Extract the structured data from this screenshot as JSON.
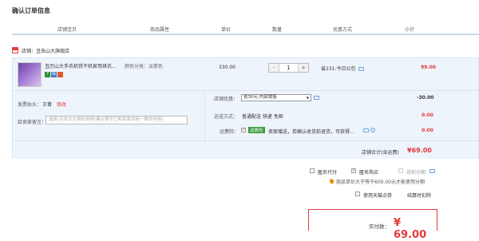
{
  "title": "确认订单信息",
  "columns": [
    "店铺宝贝",
    "商品属性",
    "单价",
    "数量",
    "优惠方式",
    "小计"
  ],
  "shop": {
    "label": "店铺：",
    "name": "丑岳山大旗舰店"
  },
  "item": {
    "name": "丑历山大手衣机铁干机家用烘衣...",
    "attr_label": "颜色分类：",
    "attr_value": "淡紫色",
    "price": "330.00",
    "qty": "1",
    "minus": "-",
    "plus": "+",
    "promo": "省231:今日公包",
    "subtotal": "99.00",
    "badges": [
      {
        "text": "7",
        "color": "#2f8f2f"
      },
      {
        "text": "保",
        "color": "#3b7ad0"
      },
      {
        "text": "",
        "color": "#e05a2a"
      }
    ]
  },
  "invoice": {
    "label": "发票抬头：",
    "name": "王菁",
    "edit": "修改"
  },
  "message": {
    "label": "给卖家留言：",
    "placeholder": "选填:对本次交易的说明(建议填写已和卖家协商一致的内容)"
  },
  "coupon": {
    "label": "店铺优惠：",
    "selected": "省30元:内部销售",
    "value": "-30.00"
  },
  "shipping": {
    "label": "运送方式：",
    "text": "普通配送 快递 免邮",
    "value": "0.00"
  },
  "insurance": {
    "label": "运费险：",
    "tag": "运费险",
    "text": "卖家赠送，若确认收货前退货，可获得...",
    "value": "0.00"
  },
  "shop_total": {
    "label": "店铺合计(含运费)",
    "value": "¥69.00"
  },
  "options": {
    "anon": "匿名代付",
    "anonymous_buy": "匿名购买",
    "installment": "花呗分期",
    "notice": "商品单价大于等于600.00元才能使用分期"
  },
  "points": {
    "label": "使用天猫点券",
    "note": "结算时扣除"
  },
  "pay": {
    "label": "实付款：",
    "value": "¥ 69.00"
  },
  "colors": {
    "accent": "#e4393c",
    "panel": "#eef4fb",
    "link": "#6d9fd6"
  }
}
